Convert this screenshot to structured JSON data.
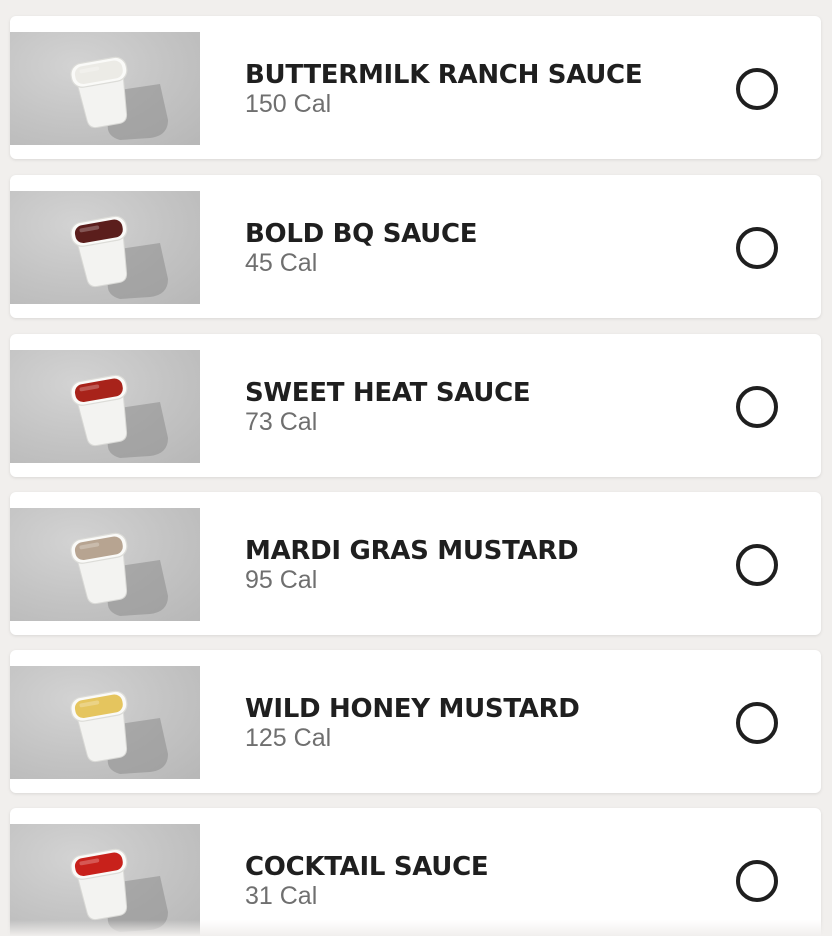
{
  "sauces": [
    {
      "name": "BUTTERMILK RANCH SAUCE",
      "calories": "150 Cal",
      "sauce_color": "#ecebe6",
      "selected": false
    },
    {
      "name": "BOLD BQ SAUCE",
      "calories": "45 Cal",
      "sauce_color": "#5b1e1c",
      "selected": false
    },
    {
      "name": "SWEET HEAT SAUCE",
      "calories": "73 Cal",
      "sauce_color": "#a8231a",
      "selected": false
    },
    {
      "name": "MARDI GRAS MUSTARD",
      "calories": "95 Cal",
      "sauce_color": "#b7a491",
      "selected": false
    },
    {
      "name": "WILD HONEY MUSTARD",
      "calories": "125 Cal",
      "sauce_color": "#e5c55e",
      "selected": false
    },
    {
      "name": "COCKTAIL SAUCE",
      "calories": "31 Cal",
      "sauce_color": "#c8211b",
      "selected": false
    }
  ],
  "icons": {
    "thumbnail": "sauce-cup-image",
    "selector": "radio-circle-icon"
  }
}
